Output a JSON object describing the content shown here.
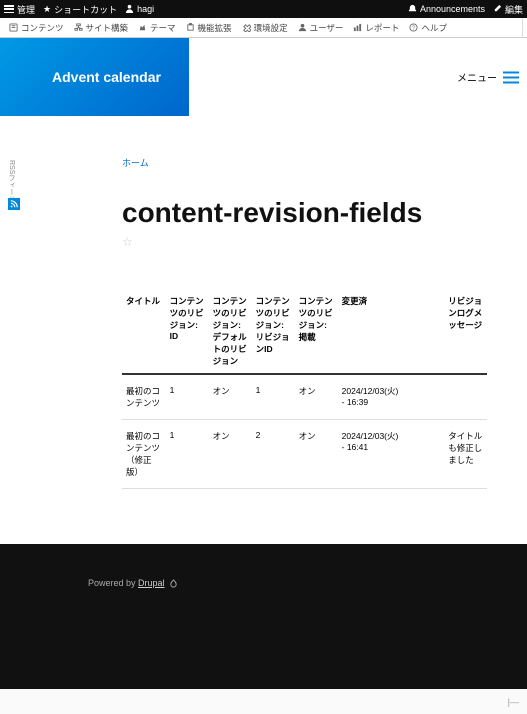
{
  "toolbar": {
    "manage": "管理",
    "shortcut": "ショートカット",
    "user": "hagi",
    "announcements": "Announcements",
    "edit": "編集"
  },
  "admin_menu": {
    "content": "コンテンツ",
    "structure": "サイト構築",
    "theme": "テーマ",
    "extend": "機能拡張",
    "config": "環境設定",
    "users": "ユーザー",
    "reports": "レポート",
    "help": "ヘルプ"
  },
  "header": {
    "site_title": "Advent calendar",
    "menu_label": "メニュー"
  },
  "side": {
    "rss": "RSSフィード"
  },
  "breadcrumb": {
    "home": "ホーム"
  },
  "page": {
    "title": "content-revision-fields"
  },
  "table": {
    "headers": {
      "title": "タイトル",
      "rev_id": "コンテンツのリビジョン: ID",
      "rev_default": "コンテンツのリビジョン: デフォルトのリビジョン",
      "rev_rid": "コンテンツのリビジョン: リビジョンID",
      "rev_pub": "コンテンツのリビジョン: 掲載",
      "changed": "変更済",
      "spacer": "",
      "log": "リビジョンログメッセージ"
    },
    "rows": [
      {
        "title": "最初のコンテンツ",
        "rev_id": "1",
        "rev_default": "オン",
        "rev_rid": "1",
        "rev_pub": "オン",
        "changed": "2024/12/03(火) - 16:39",
        "spacer": "",
        "log": ""
      },
      {
        "title": "最初のコンテンツ（修正版）",
        "rev_id": "1",
        "rev_default": "オン",
        "rev_rid": "2",
        "rev_pub": "オン",
        "changed": "2024/12/03(火) - 16:41",
        "spacer": "",
        "log": "タイトルも修正しました"
      }
    ]
  },
  "footer": {
    "powered_pre": "Powered by ",
    "powered_link": "Drupal"
  },
  "bottom": {
    "sep": "|—"
  }
}
